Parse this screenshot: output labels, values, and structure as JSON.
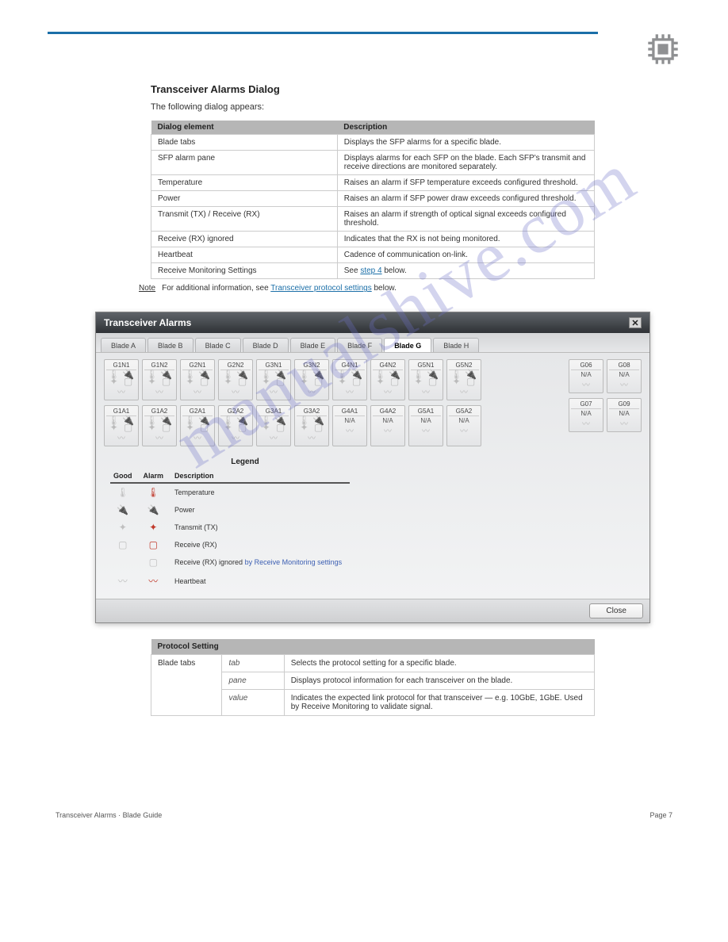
{
  "watermark": "manualshive.com",
  "chip_color": "#8f9092",
  "heading": "Transceiver Alarms Dialog",
  "intro": "The following dialog appears:",
  "spec_table": {
    "headers": [
      "Dialog element",
      "Description"
    ],
    "rows": [
      [
        "Blade tabs",
        "Displays the SFP alarms for a specific blade."
      ],
      [
        "SFP alarm pane",
        "Displays alarms for each SFP on the blade. Each SFP's transmit and receive directions are monitored separately."
      ],
      [
        "Temperature",
        "Raises an alarm if SFP temperature exceeds configured threshold."
      ],
      [
        "Power",
        "Raises an alarm if SFP power draw exceeds configured threshold."
      ],
      [
        "Transmit (TX) / Receive (RX)",
        "Raises an alarm if strength of optical signal exceeds configured threshold."
      ],
      [
        "Receive (RX) ignored",
        "Indicates that the RX is not being monitored."
      ],
      [
        "Heartbeat",
        "Cadence of communication on-link."
      ],
      [
        "Receive Monitoring Settings",
        "See step 4 below."
      ]
    ]
  },
  "note": {
    "label": "Note",
    "text": "For additional information, see ",
    "link_text": "Transceiver protocol settings",
    "suffix": " below."
  },
  "dialog": {
    "title": "Transceiver Alarms",
    "close_glyph": "✕",
    "tabs": [
      "Blade A",
      "Blade B",
      "Blade C",
      "Blade D",
      "Blade E",
      "Blade F",
      "Blade G",
      "Blade H"
    ],
    "active_tab": "Blade G",
    "row1": [
      "G1N1",
      "G1N2",
      "G2N1",
      "G2N2",
      "G3N1",
      "G3N2",
      "G4N1",
      "G4N2",
      "G5N1",
      "G5N2"
    ],
    "row2": [
      {
        "label": "G1A1",
        "na": false
      },
      {
        "label": "G1A2",
        "na": false
      },
      {
        "label": "G2A1",
        "na": false
      },
      {
        "label": "G2A2",
        "na": false
      },
      {
        "label": "G3A1",
        "na": false
      },
      {
        "label": "G3A2",
        "na": false
      },
      {
        "label": "G4A1",
        "na": true
      },
      {
        "label": "G4A2",
        "na": true
      },
      {
        "label": "G5A1",
        "na": true
      },
      {
        "label": "G5A2",
        "na": true
      }
    ],
    "side_row1": [
      {
        "label": "G06",
        "na": true
      },
      {
        "label": "G08",
        "na": true
      }
    ],
    "side_row2": [
      {
        "label": "G07",
        "na": true
      },
      {
        "label": "G09",
        "na": true
      }
    ],
    "legend_title": "Legend",
    "legend_headers": [
      "Good",
      "Alarm",
      "Description"
    ],
    "legend_rows": [
      {
        "good": "🌡",
        "alarm": "🌡",
        "alarm_class": "alarm-red",
        "desc": "Temperature"
      },
      {
        "good": "🔌",
        "alarm": "🔌",
        "alarm_class": "alarm-pink",
        "desc": "Power"
      },
      {
        "good": "✦",
        "alarm": "✦",
        "alarm_class": "alarm-red",
        "desc": "Transmit (TX)"
      },
      {
        "good": "▢",
        "alarm": "▢",
        "alarm_class": "alarm-red",
        "desc": "Receive (RX)"
      },
      {
        "good": "",
        "alarm": "▢",
        "alarm_class": "good-grey",
        "desc": "Receive (RX) ignored ",
        "link": "by Receive Monitoring settings"
      },
      {
        "good": "〰",
        "alarm": "〰",
        "alarm_class": "alarm-red",
        "desc": "Heartbeat"
      }
    ],
    "close_btn": "Close"
  },
  "proto_table": {
    "headers": [
      "Protocol Setting",
      "",
      ""
    ],
    "rows": [
      {
        "first": "Blade tabs",
        "kind": "tab",
        "desc": "Selects the protocol setting for a specific blade."
      },
      {
        "first": "",
        "kind": "pane",
        "desc": "Displays protocol information for each transceiver on the blade."
      },
      {
        "first": "",
        "kind": "value",
        "desc": "Indicates the expected link protocol for that transceiver — e.g. 10GbE, 1GbE. Used by Receive Monitoring to validate signal."
      }
    ]
  },
  "footer": {
    "left": "Transceiver Alarms · Blade Guide",
    "right": "Page 7"
  }
}
